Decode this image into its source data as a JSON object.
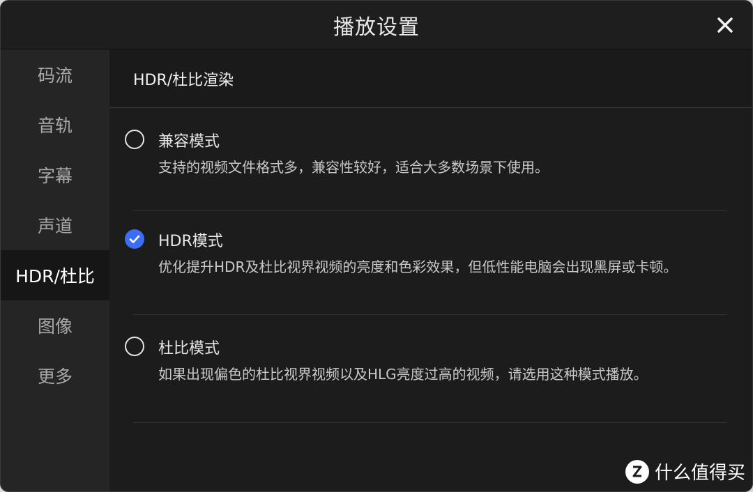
{
  "window": {
    "title": "播放设置"
  },
  "sidebar": {
    "items": [
      {
        "label": "码流"
      },
      {
        "label": "音轨"
      },
      {
        "label": "字幕"
      },
      {
        "label": "声道"
      },
      {
        "label": "HDR/杜比",
        "active": true
      },
      {
        "label": "图像"
      },
      {
        "label": "更多"
      }
    ]
  },
  "main": {
    "section_title": "HDR/杜比渲染",
    "options": [
      {
        "label": "兼容模式",
        "description": "支持的视频文件格式多，兼容性较好，适合大多数场景下使用。",
        "selected": false
      },
      {
        "label": "HDR模式",
        "description": "优化提升HDR及杜比视界视频的亮度和色彩效果，但低性能电脑会出现黑屏或卡顿。",
        "selected": true
      },
      {
        "label": "杜比模式",
        "description": "如果出现偏色的杜比视界视频以及HLG亮度过高的视频，请选用这种模式播放。",
        "selected": false
      }
    ]
  },
  "watermark": {
    "text": "什么值得买",
    "icon": "zhi-badge-icon"
  },
  "colors": {
    "accent": "#3d6df2",
    "background": "#1c1c1c",
    "sidebar": "#252525"
  }
}
